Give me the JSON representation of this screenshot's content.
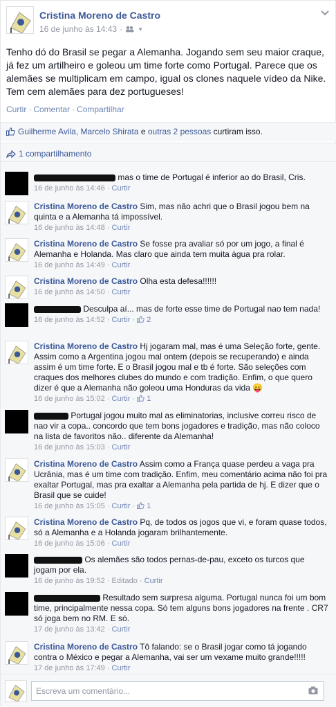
{
  "post": {
    "author": "Cristina Moreno de Castro",
    "timestamp": "16 de junho às 14:43",
    "privacy_icon": "friends-icon",
    "text": "Tenho dó do Brasil se pegar a Alemanha. Jogando sem seu maior craque, já fez um artilheiro e goleou um time forte como Portugal. Parece que os alemães se multiplicam em campo, igual os clones naquele vídeo da Nike. Tem cem alemães para dez portugueses!",
    "actions": {
      "like": "Curtir",
      "comment": "Comentar",
      "share": "Compartilhar",
      "separator": "·"
    },
    "likes": {
      "names": "Guilherme Avila, Marcelo Shirata",
      "connector": " e ",
      "others": "outras 2 pessoas",
      "suffix": " curtiram isso."
    },
    "shares": "1 compartilhamento"
  },
  "comments": [
    {
      "author": "",
      "redacted": true,
      "text": "mas o time de Portugal é inferior ao do Brasil, Cris.",
      "time": "16 de junho às 14:46",
      "like": "Curtir",
      "likes": ""
    },
    {
      "author": "Cristina Moreno de Castro",
      "redacted": false,
      "text": "Sim, mas não achri que o Brasil jogou bem na quinta e a Alemanha tá impossível.",
      "time": "16 de junho às 14:48",
      "like": "Curtir",
      "likes": ""
    },
    {
      "author": "Cristina Moreno de Castro",
      "redacted": false,
      "text": "Se fosse pra avaliar só por um jogo, a final é Alemanha e Holanda. Mas claro que ainda tem muita água pra rolar.",
      "time": "16 de junho às 14:49",
      "like": "Curtir",
      "likes": ""
    },
    {
      "author": "Cristina Moreno de Castro",
      "redacted": false,
      "text": "Olha esta defesa!!!!!!",
      "time": "16 de junho às 14:50",
      "like": "Curtir",
      "likes": ""
    },
    {
      "author": "",
      "redacted": true,
      "text": "Desculpa aí... mas de forte esse time de Portugal nao tem nada!",
      "time": "16 de junho às 14:52",
      "like": "Curtir",
      "likes": "2"
    },
    {
      "author": "Cristina Moreno de Castro",
      "redacted": false,
      "text": "Hj jogaram mal, mas é uma Seleção forte, gente. Assim como a Argentina jogou mal ontem (depois se recuperando) e ainda assim é um time forte. E o Brasil jogou mal e tb é forte. São seleções com craques dos melhores clubes do mundo e com tradição. Enfim, o que quero dizer é que a Alemanha não goleou uma Honduras da vida 😛",
      "time": "16 de junho às 15:02",
      "like": "Curtir",
      "likes": "1"
    },
    {
      "author": "",
      "redacted": true,
      "text": "Portugal jogou muito mal as eliminatorias, inclusive correu risco de nao vir a copa.. concordo que tem bons jogadores e tradição, mas não coloco na lista de favoritos não.. diferente da Alemanha!",
      "time": "16 de junho às 15:03",
      "like": "Curtir",
      "likes": ""
    },
    {
      "author": "Cristina Moreno de Castro",
      "redacted": false,
      "text": "Assim como a França quase perdeu a vaga pra Ucrânia, mas é um time com tradição. Enfim, meu comentário acima não foi pra exaltar Portugal, mas pra exaltar a Alemanha pela partida de hj. E dizer que o Brasil que se cuide!",
      "time": "16 de junho às 15:05",
      "like": "Curtir",
      "likes": "1"
    },
    {
      "author": "Cristina Moreno de Castro",
      "redacted": false,
      "text": "Pq, de todos os jogos que vi, e foram quase todos, só a Alemanha e a Holanda jogaram brilhantemente.",
      "time": "16 de junho às 15:06",
      "like": "Curtir",
      "likes": ""
    },
    {
      "author": "",
      "redacted": true,
      "text": "Os alemães são todos pernas-de-pau, exceto os turcos que jogam por ela.",
      "time": "16 de junho às 19:52 · Editado",
      "like": "Curtir",
      "likes": ""
    },
    {
      "author": "",
      "redacted": true,
      "text": "Resultado sem surpresa alguma. Portugal nunca foi um bom time, principalmente nessa copa. Só tem alguns bons jogadores na frente . CR7 só joga bem no RM. E só.",
      "time": "17 de junho às 13:42",
      "like": "Curtir",
      "likes": ""
    },
    {
      "author": "Cristina Moreno de Castro",
      "redacted": false,
      "text": "Tô falando: se o Brasil jogar como tá jogando contra o México e pegar a Alemanha, vai ser um vexame muito grande!!!!!",
      "time": "17 de junho às 17:49",
      "like": "Curtir",
      "likes": ""
    }
  ],
  "compose": {
    "placeholder": "Escreva um comentário..."
  },
  "colors": {
    "link": "#3b5998",
    "meta": "#9197a3",
    "background": "#f6f7f9"
  }
}
